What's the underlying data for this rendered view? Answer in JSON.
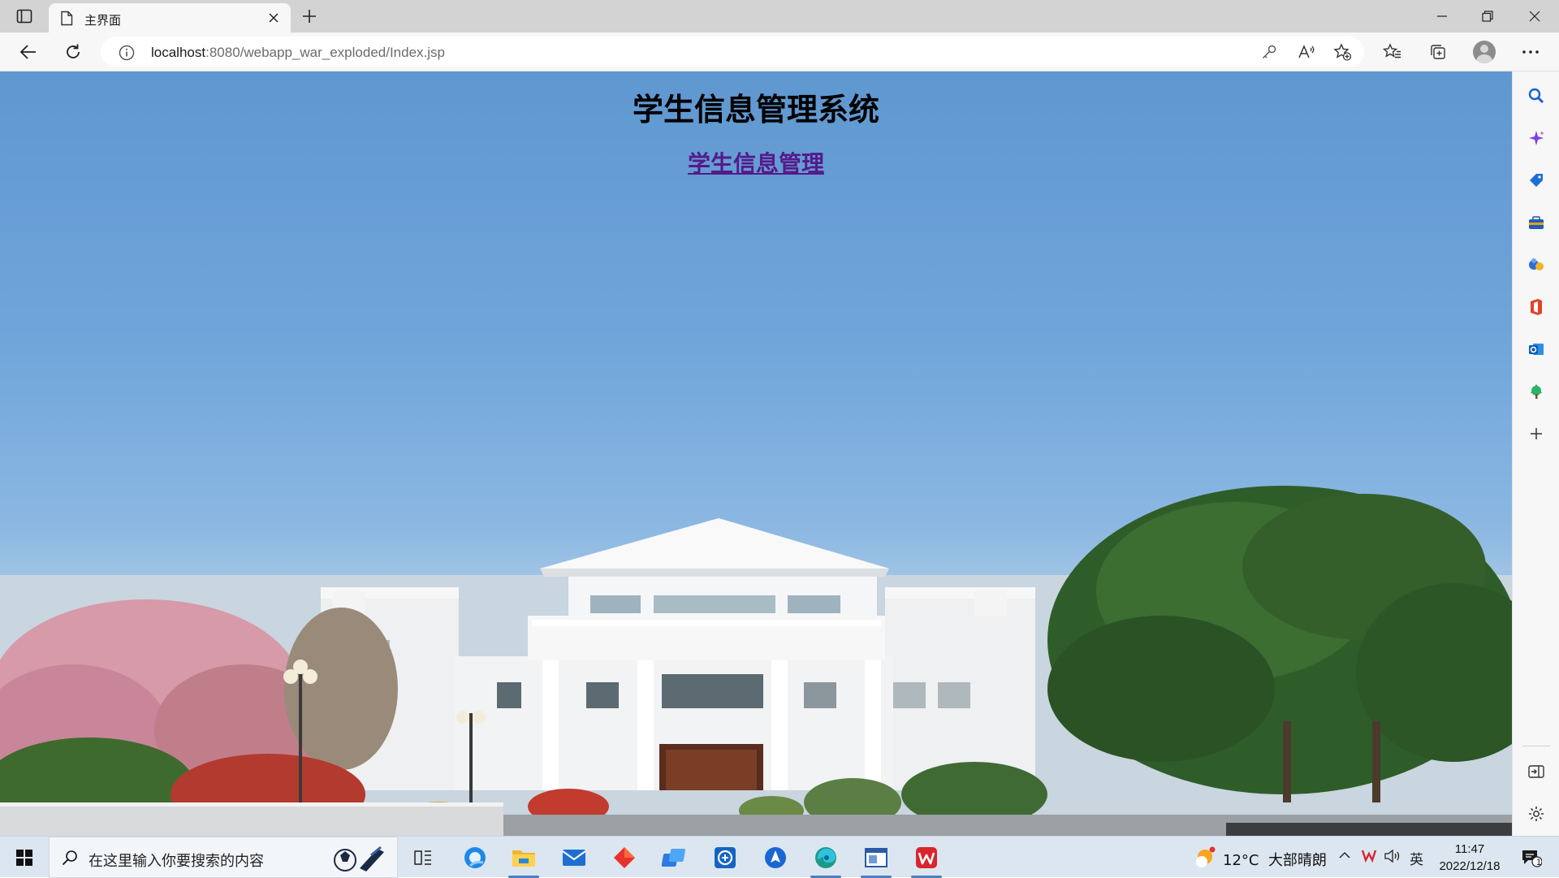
{
  "browser": {
    "tab_title": "主界面",
    "url_host": "localhost",
    "url_path": ":8080/webapp_war_exploded/Index.jsp"
  },
  "page": {
    "heading": "学生信息管理系统",
    "link_text": "学生信息管理"
  },
  "sidebar": {
    "items": [
      "search-icon",
      "copilot-icon",
      "shopping-icon",
      "tools-icon",
      "games-icon",
      "office-icon",
      "outlook-icon",
      "tree-icon",
      "add-icon",
      "hide-sidebar-icon",
      "settings-icon"
    ]
  },
  "taskbar": {
    "search_placeholder": "在这里输入你要搜索的内容",
    "weather_temp": "12°C",
    "weather_desc": "大部晴朗",
    "ime": "英",
    "time": "11:47",
    "date": "2022/12/18",
    "notification_count": "1",
    "colors": {
      "accent": "#4a7fbf",
      "wps": "#d7262f"
    }
  }
}
